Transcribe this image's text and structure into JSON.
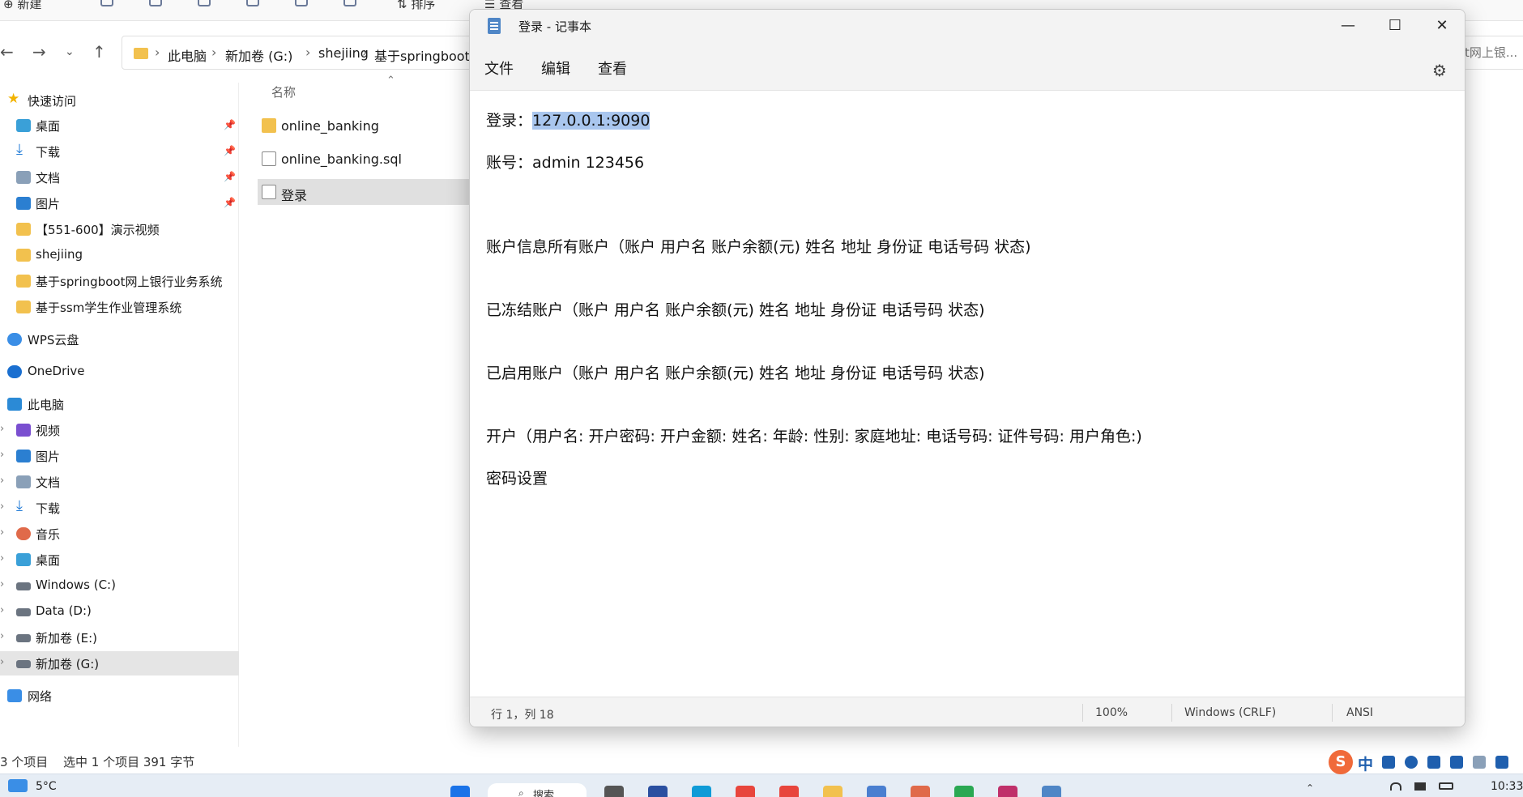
{
  "explorer": {
    "ribbon": {
      "new_label": "新建",
      "sort_label": "排序",
      "view_label": "查看"
    },
    "breadcrumb": [
      "此电脑",
      "新加卷 (G:)",
      "shejiing",
      "基于springboot网"
    ],
    "breadcrumb_overflow": "t网上银...",
    "nav": {
      "quick_access": "快速访问",
      "pinned": [
        "桌面",
        "下载",
        "文档",
        "图片"
      ],
      "recent": [
        "【551-600】演示视频",
        "shejiing",
        "基于springboot网上银行业务系统",
        "基于ssm学生作业管理系统"
      ],
      "wps": "WPS云盘",
      "onedrive": "OneDrive",
      "this_pc": "此电脑",
      "pc_items": [
        "视频",
        "图片",
        "文档",
        "下载",
        "音乐",
        "桌面",
        "Windows (C:)",
        "Data (D:)",
        "新加卷 (E:)",
        "新加卷 (G:)"
      ],
      "network": "网络"
    },
    "column_header": "名称",
    "files": [
      {
        "name": "online_banking",
        "type": "folder"
      },
      {
        "name": "online_banking.sql",
        "type": "file"
      },
      {
        "name": "登录",
        "type": "txt",
        "selected": true
      }
    ],
    "status": {
      "count": "3 个项目",
      "selection": "选中 1 个项目  391 字节"
    }
  },
  "notepad": {
    "title": "登录 - 记事本",
    "menu": [
      "文件",
      "编辑",
      "查看"
    ],
    "lines": {
      "login_prefix": "登录：",
      "login_value": "127.0.0.1:9090",
      "account": "账号：admin   123456",
      "l3": "账户信息所有账户（账户 用户名 账户余额(元) 姓名 地址 身份证 电话号码 状态)",
      "l4": "已冻结账户（账户 用户名 账户余额(元) 姓名 地址 身份证 电话号码 状态)",
      "l5": "已启用账户（账户 用户名 账户余额(元) 姓名 地址 身份证 电话号码 状态)",
      "l6": "开户（用户名: 开户密码: 开户金额: 姓名: 年龄: 性别: 家庭地址: 电话号码: 证件号码: 用户角色:)",
      "l7": "密码设置"
    },
    "status": {
      "position": "行 1，列 18",
      "zoom": "100%",
      "eol": "Windows (CRLF)",
      "encoding": "ANSI"
    }
  },
  "taskbar": {
    "weather": "5°C",
    "search": "搜索",
    "time": "10:33",
    "ime_label": "中"
  },
  "colors": {
    "selection": "#a9c6ee",
    "folder": "#f2c14e",
    "accent": "#1f5fae"
  }
}
